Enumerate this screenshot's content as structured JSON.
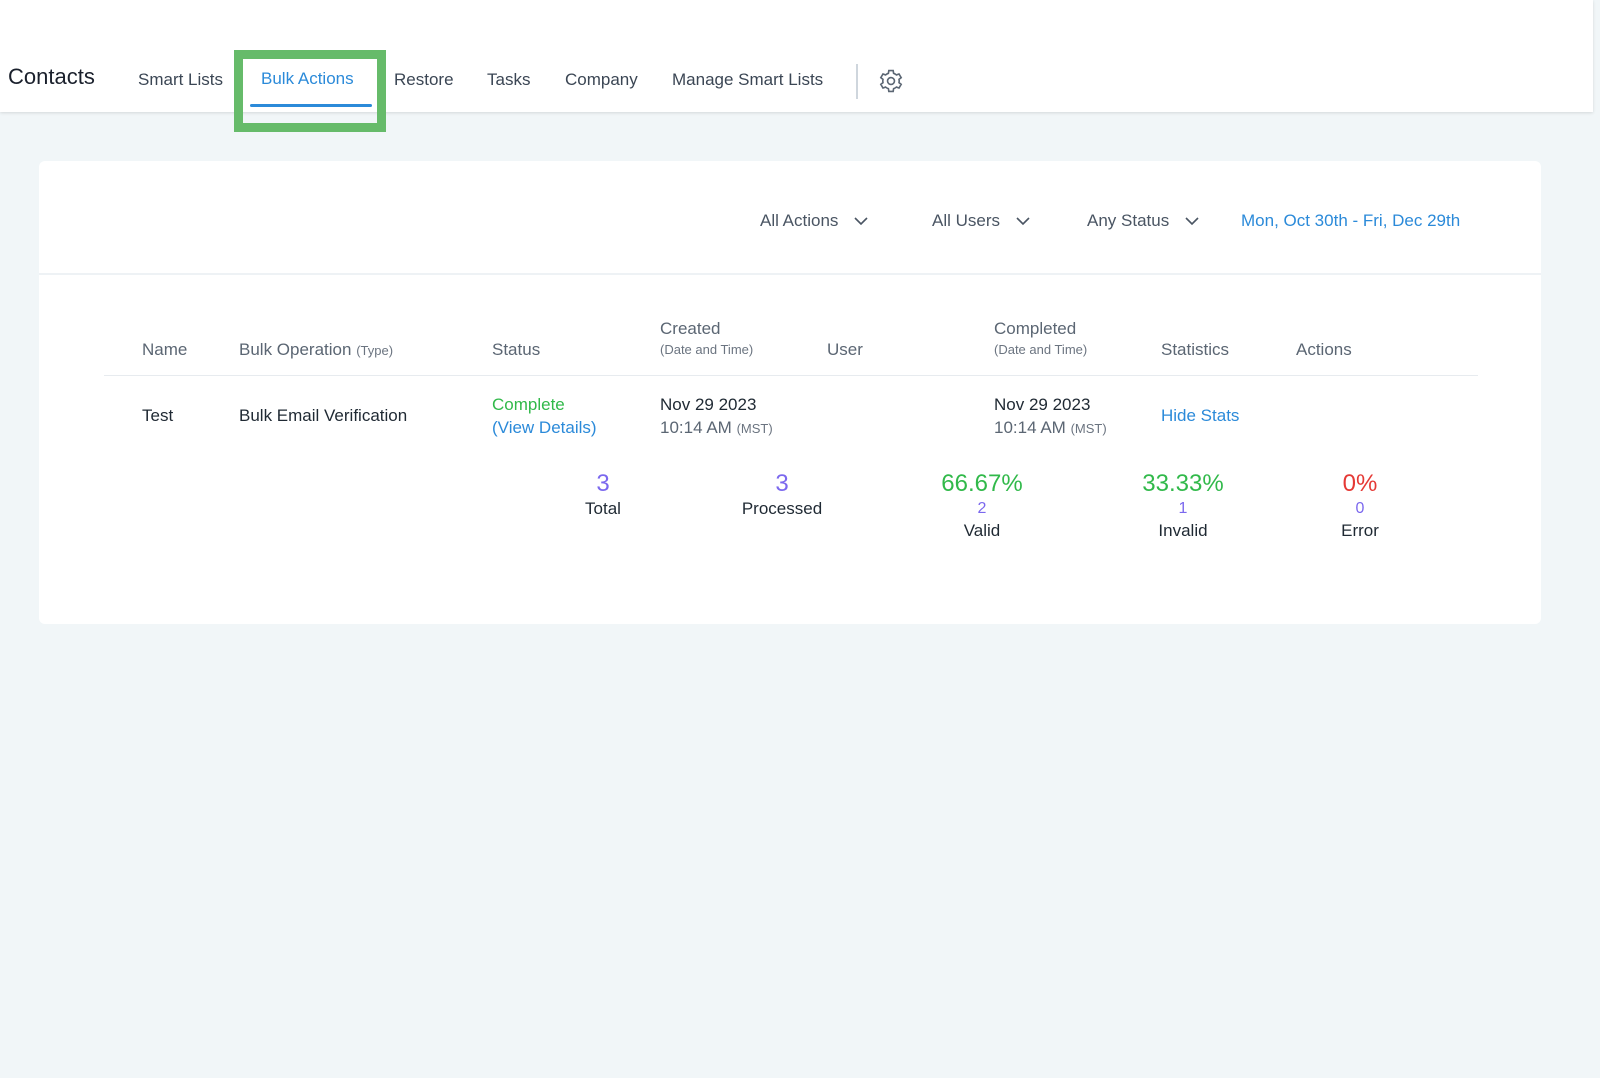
{
  "header": {
    "title": "Contacts",
    "tabs": [
      {
        "label": "Smart Lists"
      },
      {
        "label": "Bulk Actions"
      },
      {
        "label": "Restore"
      },
      {
        "label": "Tasks"
      },
      {
        "label": "Company"
      },
      {
        "label": "Manage Smart Lists"
      }
    ],
    "active_tab": "Bulk Actions",
    "settings_icon": "gear-icon"
  },
  "filters": {
    "actions": "All Actions",
    "users": "All Users",
    "status": "Any Status",
    "date_range": "Mon, Oct 30th - Fri, Dec 29th"
  },
  "table": {
    "columns": {
      "name": "Name",
      "operation": "Bulk Operation",
      "operation_sub": "(Type)",
      "status": "Status",
      "created": "Created",
      "created_sub": "(Date and Time)",
      "user": "User",
      "completed": "Completed",
      "completed_sub": "(Date and Time)",
      "statistics": "Statistics",
      "actions": "Actions"
    },
    "rows": [
      {
        "name": "Test",
        "operation": "Bulk Email Verification",
        "status": "Complete",
        "status_link": "(View Details)",
        "created_date": "Nov 29 2023",
        "created_time": "10:14 AM",
        "created_tz": "(MST)",
        "user": "",
        "completed_date": "Nov 29 2023",
        "completed_time": "10:14 AM",
        "completed_tz": "(MST)",
        "statistics_link": "Hide Stats"
      }
    ]
  },
  "stats": {
    "total": {
      "value": "3",
      "label": "Total"
    },
    "processed": {
      "value": "3",
      "label": "Processed"
    },
    "valid": {
      "percent": "66.67%",
      "count": "2",
      "label": "Valid"
    },
    "invalid": {
      "percent": "33.33%",
      "count": "1",
      "label": "Invalid"
    },
    "error": {
      "percent": "0%",
      "count": "0",
      "label": "Error"
    }
  },
  "colors": {
    "accent": "#2b8ad9",
    "success": "#31b94a",
    "error": "#e53935",
    "count": "#7b68ee",
    "highlight": "#66bb6a"
  }
}
